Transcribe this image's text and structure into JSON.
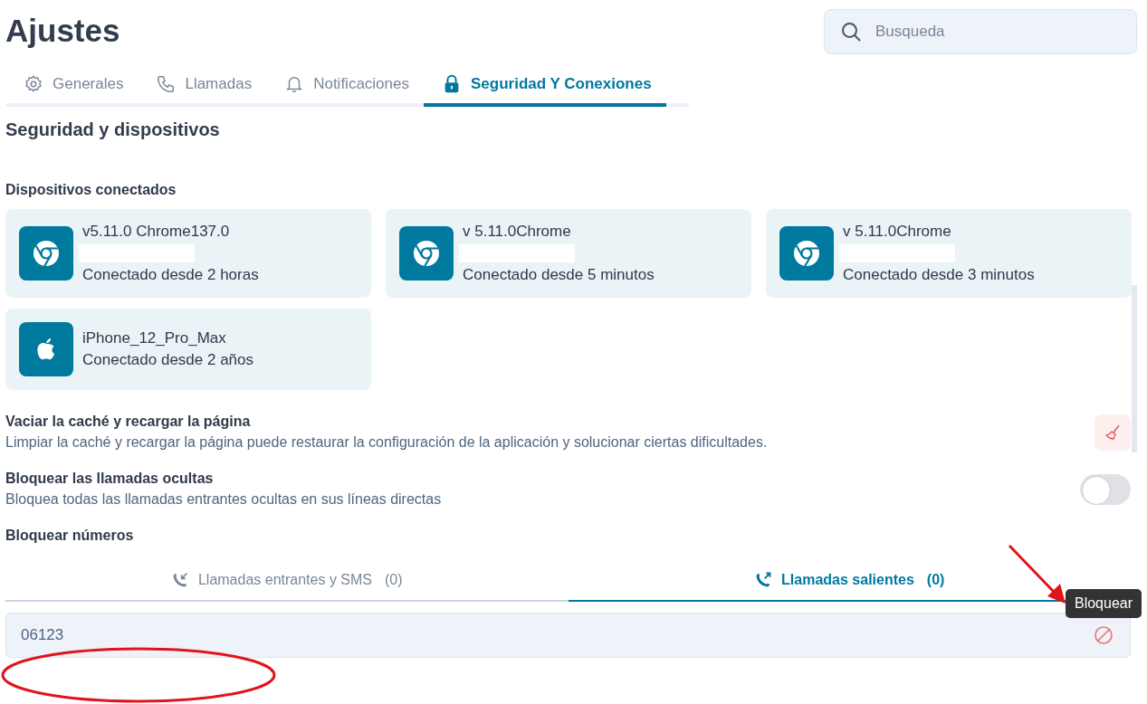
{
  "title": "Ajustes",
  "search": {
    "placeholder": "Busqueda"
  },
  "tabs": [
    {
      "label": "Generales",
      "kind": "gear",
      "selected": false
    },
    {
      "label": "Llamadas",
      "kind": "phone",
      "selected": false
    },
    {
      "label": "Notificaciones",
      "kind": "bell",
      "selected": false
    },
    {
      "label": "Seguridad Y Conexiones",
      "kind": "lock",
      "selected": true
    }
  ],
  "section_title": "Seguridad y dispositivos",
  "devices_title": "Dispositivos conectados",
  "devices": [
    {
      "kind": "chrome",
      "name": "v5.11.0 Chrome137.0",
      "redacted": true,
      "connected": "Conectado desde 2 horas"
    },
    {
      "kind": "chrome",
      "name": "v 5.11.0Chrome",
      "redacted": true,
      "connected": "Conectado desde 5 minutos"
    },
    {
      "kind": "chrome",
      "name": "v 5.11.0Chrome",
      "redacted": true,
      "connected": "Conectado desde 3 minutos"
    },
    {
      "kind": "apple",
      "name": "iPhone_12_Pro_Max",
      "redacted": false,
      "connected": "Conectado desde 2 años"
    }
  ],
  "settings": [
    {
      "kind": "button",
      "title": "Vaciar la caché y recargar la página",
      "description": "Limpiar la caché y recargar la página puede restaurar la configuración de la aplicación y solucionar ciertas dificultades."
    },
    {
      "kind": "toggle",
      "title": "Bloquear las llamadas ocultas",
      "description": "Bloquea todas las llamadas entrantes ocultas en sus líneas directas",
      "on": false
    }
  ],
  "block_title": "Bloquear números",
  "block_tabs": [
    {
      "kind": "incoming",
      "label": "Llamadas entrantes y SMS",
      "count": "(0)",
      "selected": false
    },
    {
      "kind": "outgoing",
      "label": "Llamadas salientes",
      "count": "(0)",
      "selected": true
    }
  ],
  "blocked_numbers": [
    {
      "number": "06123",
      "tooltip": "Bloquear"
    }
  ]
}
